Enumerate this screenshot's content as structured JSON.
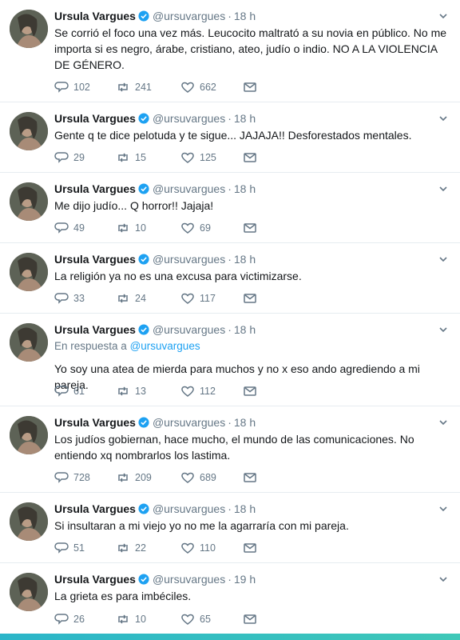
{
  "colors": {
    "verified": "#1da1f2",
    "secondary_text": "#657786",
    "primary_text": "#14171a",
    "divider": "#e6ecf0",
    "bottom_strip": "#2bb5c9"
  },
  "icons": {
    "verified": "verified-badge-icon",
    "caret": "chevron-down-icon",
    "reply": "reply-icon",
    "retweet": "retweet-icon",
    "like": "heart-icon",
    "dm": "envelope-icon"
  },
  "tweets": [
    {
      "name": "Ursula Vargues",
      "handle": "@ursuvargues",
      "dot": "·",
      "time": "18 h",
      "text": "Se corrió el foco una vez más. Leucocito maltrató a su novia en público. No me importa si es negro, árabe, cristiano, ateo, judío  o indio. NO A LA VIOLENCIA DE GÉNERO.",
      "replies": "102",
      "retweets": "241",
      "likes": "662"
    },
    {
      "name": "Ursula Vargues",
      "handle": "@ursuvargues",
      "dot": "·",
      "time": "18 h",
      "text": "Gente q te dice pelotuda y te sigue... JAJAJA!! Desforestados mentales.",
      "replies": "29",
      "retweets": "15",
      "likes": "125"
    },
    {
      "name": "Ursula Vargues",
      "handle": "@ursuvargues",
      "dot": "·",
      "time": "18 h",
      "text": "Me dijo judío... Q horror!! Jajaja!",
      "replies": "49",
      "retweets": "10",
      "likes": "69"
    },
    {
      "name": "Ursula Vargues",
      "handle": "@ursuvargues",
      "dot": "·",
      "time": "18 h",
      "text": "La religión ya no es una excusa para victimizarse.",
      "replies": "33",
      "retweets": "24",
      "likes": "117"
    },
    {
      "name": "Ursula Vargues",
      "handle": "@ursuvargues",
      "dot": "·",
      "time": "18 h",
      "reply_prefix": "En respuesta a",
      "reply_to": "@ursuvargues",
      "text": "Yo soy una atea de mierda para muchos y no x eso ando agrediendo a mi pareja.",
      "replies": "61",
      "retweets": "13",
      "likes": "112"
    },
    {
      "name": "Ursula Vargues",
      "handle": "@ursuvargues",
      "dot": "·",
      "time": "18 h",
      "text": "Los judíos gobiernan, hace mucho, el mundo de las comunicaciones. No entiendo xq nombrarlos los lastima.",
      "replies": "728",
      "retweets": "209",
      "likes": "689"
    },
    {
      "name": "Ursula Vargues",
      "handle": "@ursuvargues",
      "dot": "·",
      "time": "18 h",
      "text": "Si insultaran a mi viejo yo no me la agarraría con mi pareja.",
      "replies": "51",
      "retweets": "22",
      "likes": "110"
    },
    {
      "name": "Ursula Vargues",
      "handle": "@ursuvargues",
      "dot": "·",
      "time": "19 h",
      "text": "La grieta es para imbéciles.",
      "replies": "26",
      "retweets": "10",
      "likes": "65"
    }
  ]
}
